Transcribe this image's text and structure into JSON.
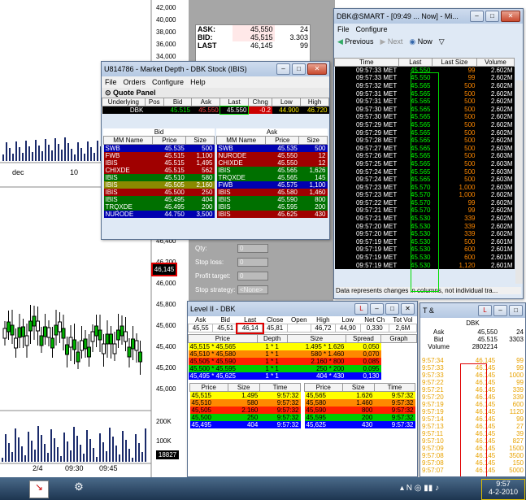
{
  "background_chart": {
    "right_axis_top": [
      "42,000",
      "40,000",
      "38,000",
      "36,000",
      "34,000"
    ],
    "right_axis_bottom": [
      "46,400",
      "46,200",
      "46,000",
      "45,800",
      "45,600",
      "45,400",
      "45,200",
      "45,000"
    ],
    "volume_axis": [
      "200K",
      "100K"
    ],
    "x_labels_top": [
      "dec",
      "10"
    ],
    "x_labels_bottom": [
      "2/4",
      "09:30",
      "09:45"
    ],
    "price_tag": "46,145",
    "volume_tag": "18827"
  },
  "quote_strip": {
    "ask_label": "ASK:",
    "ask": "45,550",
    "ask_size": "24",
    "bid_label": "BID:",
    "bid": "45,515",
    "bid_size": "3.303",
    "last_label": "LAST",
    "last": "46,145",
    "last_size": "99"
  },
  "market_depth": {
    "title": "U814786 - Market Depth - DBK Stock (IBIS)",
    "menu": [
      "File",
      "Orders",
      "Configure",
      "Help"
    ],
    "quote_panel": "Quote Panel",
    "quote_headers": [
      "Underlying",
      "Pos",
      "Bid",
      "Ask",
      "Last",
      "Chng",
      "Low",
      "High"
    ],
    "quote_row": [
      "DBK",
      "",
      "45.515",
      "45.550",
      "45.550",
      "-0.2",
      "44.900",
      "46.720"
    ],
    "bid_label": "Bid",
    "ask_label": "Ask",
    "cols": [
      "MM Name",
      "Price",
      "Size"
    ],
    "bids": [
      {
        "mm": "SWB",
        "price": "45.535",
        "size": "500",
        "c": "#0000b0"
      },
      {
        "mm": "FWB",
        "price": "45.515",
        "size": "1,100",
        "c": "#a00000"
      },
      {
        "mm": "IBIS",
        "price": "45.515",
        "size": "1,495",
        "c": "#a00000"
      },
      {
        "mm": "CHIXDE",
        "price": "45.515",
        "size": "562",
        "c": "#a00000"
      },
      {
        "mm": "IBIS",
        "price": "45.510",
        "size": "580",
        "c": "#007000"
      },
      {
        "mm": "IBIS",
        "price": "45.505",
        "size": "2,160",
        "c": "#8a8a00"
      },
      {
        "mm": "IBIS",
        "price": "45.500",
        "size": "250",
        "c": "#a00000"
      },
      {
        "mm": "IBIS",
        "price": "45.495",
        "size": "404",
        "c": "#007000"
      },
      {
        "mm": "TRQXDE",
        "price": "45.495",
        "size": "200",
        "c": "#007000"
      },
      {
        "mm": "NURODE",
        "price": "44.750",
        "size": "3,500",
        "c": "#0000b0"
      }
    ],
    "asks": [
      {
        "mm": "SWB",
        "price": "45.535",
        "size": "500",
        "c": "#0000b0"
      },
      {
        "mm": "NURODE",
        "price": "45.550",
        "size": "12",
        "c": "#a00000"
      },
      {
        "mm": "CHIXDE",
        "price": "45.550",
        "size": "12",
        "c": "#a00000"
      },
      {
        "mm": "IBIS",
        "price": "45.565",
        "size": "1,626",
        "c": "#007000"
      },
      {
        "mm": "TRQXDE",
        "price": "45.565",
        "size": "145",
        "c": "#007000"
      },
      {
        "mm": "FWB",
        "price": "45.575",
        "size": "1,100",
        "c": "#0000b0"
      },
      {
        "mm": "IBIS",
        "price": "45.580",
        "size": "1,460",
        "c": "#a00000"
      },
      {
        "mm": "IBIS",
        "price": "45.590",
        "size": "800",
        "c": "#007000"
      },
      {
        "mm": "IBIS",
        "price": "45.595",
        "size": "200",
        "c": "#007000"
      },
      {
        "mm": "IBIS",
        "price": "45.625",
        "size": "430",
        "c": "#a00000"
      }
    ]
  },
  "order_fields": [
    {
      "label": "Qty:",
      "value": "0"
    },
    {
      "label": "Stop loss:",
      "value": "0"
    },
    {
      "label": "Profit target:",
      "value": "0"
    },
    {
      "label": "Stop strategy:",
      "value": "<None>"
    }
  ],
  "smart": {
    "title": "DBK@SMART - [09:49 ... Now] - Mi...",
    "menu": [
      "File",
      "Configure"
    ],
    "nav": [
      "Previous",
      "Next",
      "Now"
    ],
    "cols": [
      "Time",
      "Last",
      "Last Size",
      "Volume"
    ],
    "rows": [
      [
        "09:57:33 MET",
        "45.550",
        "99",
        "2.602M"
      ],
      [
        "09:57:33 MET",
        "45.550",
        "99",
        "2.602M"
      ],
      [
        "09:57:32 MET",
        "45.565",
        "500",
        "2.602M"
      ],
      [
        "09:57:31 MET",
        "45.565",
        "500",
        "2.602M"
      ],
      [
        "09:57:31 MET",
        "45.565",
        "500",
        "2.602M"
      ],
      [
        "09:57:30 MET",
        "45.565",
        "500",
        "2.602M"
      ],
      [
        "09:57:30 MET",
        "45.565",
        "500",
        "2.602M"
      ],
      [
        "09:57:29 MET",
        "45.565",
        "500",
        "2.602M"
      ],
      [
        "09:57:29 MET",
        "45.565",
        "500",
        "2.602M"
      ],
      [
        "09:57:28 MET",
        "45.565",
        "500",
        "2.602M"
      ],
      [
        "09:57:27 MET",
        "45.565",
        "500",
        "2.603M"
      ],
      [
        "09:57:26 MET",
        "45.565",
        "500",
        "2.603M"
      ],
      [
        "09:57:25 MET",
        "45.565",
        "500",
        "2.603M"
      ],
      [
        "09:57:24 MET",
        "45.565",
        "500",
        "2.603M"
      ],
      [
        "09:57:24 MET",
        "45.565",
        "500",
        "2.603M"
      ],
      [
        "09:57:23 MET",
        "45.570",
        "1,000",
        "2.603M"
      ],
      [
        "09:57:23 MET",
        "45.570",
        "1,000",
        "2.602M"
      ],
      [
        "09:57:22 MET",
        "45.570",
        "99",
        "2.602M"
      ],
      [
        "09:57:21 MET",
        "45.570",
        "99",
        "2.602M"
      ],
      [
        "09:57:21 MET",
        "45.530",
        "339",
        "2.602M"
      ],
      [
        "09:57:20 MET",
        "45.530",
        "339",
        "2.602M"
      ],
      [
        "09:57:20 MET",
        "45.530",
        "339",
        "2.602M"
      ],
      [
        "09:57:19 MET",
        "45.530",
        "500",
        "2.601M"
      ],
      [
        "09:57:19 MET",
        "45.530",
        "600",
        "2.601M"
      ],
      [
        "09:57:19 MET",
        "45.530",
        "600",
        "2.601M"
      ],
      [
        "09:57:19 MET",
        "45.530",
        "1,120",
        "2.601M"
      ]
    ],
    "status": "Data represents changes in columns, not individual tra..."
  },
  "level2": {
    "title": "Level II - DBK",
    "headers": [
      "Ask",
      "Bid",
      "Last",
      "Close",
      "Open",
      "High",
      "Low",
      "Net Ch",
      "Tot Vol"
    ],
    "values": [
      "45,55",
      "45,51",
      "46,14",
      "45,81",
      "",
      "46,72",
      "44,90",
      "0,330",
      "2,6M"
    ],
    "book_headers": [
      "Price",
      "Depth",
      "Size",
      "Spread",
      "Graph"
    ],
    "book": [
      {
        "price": "45,515 * 45,565",
        "depth": "1 * 1",
        "size": "1.495 * 1.626",
        "spread": "0,050",
        "bg": "#ffff00"
      },
      {
        "price": "45,510 * 45,580",
        "depth": "1 * 1",
        "size": "580 * 1.460",
        "spread": "0,070",
        "bg": "#ff8800"
      },
      {
        "price": "45,505 * 45,590",
        "depth": "1 * 1",
        "size": "2.160 * 800",
        "spread": "0,085",
        "bg": "#ff2200"
      },
      {
        "price": "45,500 * 45,595",
        "depth": "1 * 1",
        "size": "250 * 200",
        "spread": "0,095",
        "bg": "#00cc00"
      },
      {
        "price": "45,495 * 45,625",
        "depth": "1 * 1",
        "size": "404 * 430",
        "spread": "0,130",
        "bg": "#0000ff"
      }
    ],
    "list_headers": [
      "Price",
      "Size",
      "Time"
    ],
    "bid_list": [
      {
        "p": "45,515",
        "s": "1.495",
        "t": "9:57:32",
        "bg": "#ffff00"
      },
      {
        "p": "45,510",
        "s": "580",
        "t": "9:57:32",
        "bg": "#ff8800"
      },
      {
        "p": "45,505",
        "s": "2.160",
        "t": "9:57:32",
        "bg": "#ff2200"
      },
      {
        "p": "45,500",
        "s": "250",
        "t": "9:57:32",
        "bg": "#00cc00"
      },
      {
        "p": "45,495",
        "s": "404",
        "t": "9:57:32",
        "bg": "#0000ff"
      }
    ],
    "ask_list": [
      {
        "p": "45,565",
        "s": "1.626",
        "t": "9:57:32",
        "bg": "#ffff00"
      },
      {
        "p": "45,580",
        "s": "1.460",
        "t": "9:57:32",
        "bg": "#ff8800"
      },
      {
        "p": "45,590",
        "s": "800",
        "t": "9:57:32",
        "bg": "#ff2200"
      },
      {
        "p": "45,595",
        "s": "200",
        "t": "9:57:32",
        "bg": "#00cc00"
      },
      {
        "p": "45,625",
        "s": "430",
        "t": "9:57:32",
        "bg": "#0000ff"
      }
    ]
  },
  "ts": {
    "title": "T &",
    "symbol": "DBK",
    "ask_label": "Ask",
    "ask": "45,550",
    "ask_size": "24",
    "bid_label": "Bid",
    "bid": "45.515",
    "bid_size": "3303",
    "vol_label": "Volume",
    "volume": "2802214",
    "rows": [
      [
        "9:57:34",
        "46.145",
        "99"
      ],
      [
        "9:57:33",
        "46.145",
        "99"
      ],
      [
        "9:57:33",
        "46.145",
        "1000"
      ],
      [
        "9:57:22",
        "46.145",
        "99"
      ],
      [
        "9:57:21",
        "46.145",
        "339"
      ],
      [
        "9:57:20",
        "46.145",
        "339"
      ],
      [
        "9:57:19",
        "46.145",
        "600"
      ],
      [
        "9:57:19",
        "46.145",
        "1120"
      ],
      [
        "9:57:14",
        "46.145",
        "99"
      ],
      [
        "9:57:13",
        "46.145",
        "27"
      ],
      [
        "9:57:11",
        "46.145",
        "39"
      ],
      [
        "9:57:10",
        "46.145",
        "827"
      ],
      [
        "9:57:09",
        "46.145",
        "1500"
      ],
      [
        "9:57:08",
        "46.145",
        "3500"
      ],
      [
        "9:57:08",
        "46.145",
        "150"
      ],
      [
        "9:57:07",
        "46.145",
        "5000"
      ]
    ]
  },
  "taskbar": {
    "time": "9:57",
    "date": "4-2-2010"
  }
}
